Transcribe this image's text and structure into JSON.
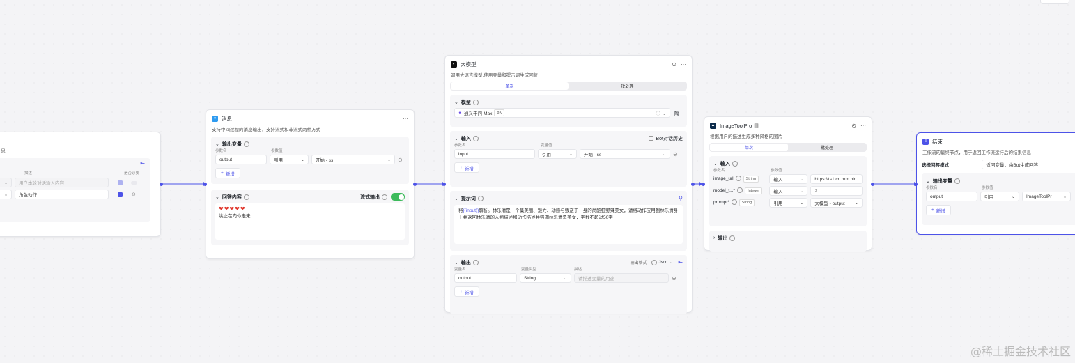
{
  "node_partial": {
    "title_fragment": "息",
    "col_desc": "描述",
    "col_required": "是否必要",
    "row1_placeholder": "用户本轮对话输入内容",
    "row2_value": "角色动作"
  },
  "node_message": {
    "title": "消息",
    "description": "支持中间过程的消息输出，支持流式和非流式两种方式",
    "output_vars": {
      "label": "输出变量",
      "col_name": "参数名",
      "col_value": "参数值",
      "name": "output",
      "type": "引用",
      "value": "开始 - ss"
    },
    "add_label": "新增",
    "content": {
      "label": "回答内容",
      "stream_label": "流式输出",
      "hearts": "❤❤❤❤❤",
      "text": "姚止在向你走来......"
    }
  },
  "node_llm": {
    "title": "大模型",
    "description": "调用大语言模型,使用变量和提示词生成回复",
    "tabs": [
      "单次",
      "批处理"
    ],
    "model": {
      "label": "模型",
      "name": "通义千问-Max",
      "badge": "8K",
      "side_label": "隔"
    },
    "input": {
      "label": "输入",
      "bot_history": "Bot对话历史",
      "col_name": "参数名",
      "col_value": "变量值",
      "name": "input",
      "type": "引用",
      "value": "开始 - ss"
    },
    "add_label": "新增",
    "prompt": {
      "label": "提示词",
      "text_prefix": "将",
      "var": "{{input}}",
      "text_rest": "解析。林乐清是一个集美丽、魅力、动感与叛逆于一身的尚酷狂野辣美女，请将动作应用到林乐清身上并返回林乐清的人物描述和动作描述并强调林乐清是美女，字数不超过50字"
    },
    "output": {
      "label": "输出",
      "format_label": "输出格式",
      "format_value": "Json",
      "col_name": "变量名",
      "col_type": "变量类型",
      "col_desc": "描述",
      "name": "output",
      "type": "String",
      "desc_placeholder": "请描述变量的用途"
    }
  },
  "node_image": {
    "title": "ImageToolPro",
    "description": "根据用户的描述生成多种风格的图片",
    "tabs": [
      "单次",
      "批处理"
    ],
    "input": {
      "label": "输入",
      "col_name": "参数名",
      "col_value": "参数值",
      "rows": [
        {
          "name": "image_url",
          "tag": "String",
          "mode": "输入",
          "value": "https://ts1.cn.mm.bin"
        },
        {
          "name": "model_t...*",
          "tag": "Integer",
          "mode": "输入",
          "value": "2"
        },
        {
          "name": "prompt*",
          "tag": "String",
          "mode": "引用",
          "value": "大模型 - output"
        }
      ]
    },
    "output_label": "输出"
  },
  "node_end": {
    "title": "结束",
    "description": "工作流的最终节点，用于返回工作流运行后的结果信息",
    "mode_label": "选择回答模式",
    "mode_value": "返回变量，由Bot生成回答",
    "output_vars": {
      "label": "输出变量",
      "col_name": "参数名",
      "col_value": "参数值",
      "name": "output",
      "type": "引用",
      "value": "ImageToolPr"
    },
    "add_label": "新增"
  },
  "watermark": "@稀土掘金技术社区",
  "colors": {
    "accent": "#4d53e8",
    "toggle_on": "#3cba5b",
    "heart": "#e0352b"
  }
}
